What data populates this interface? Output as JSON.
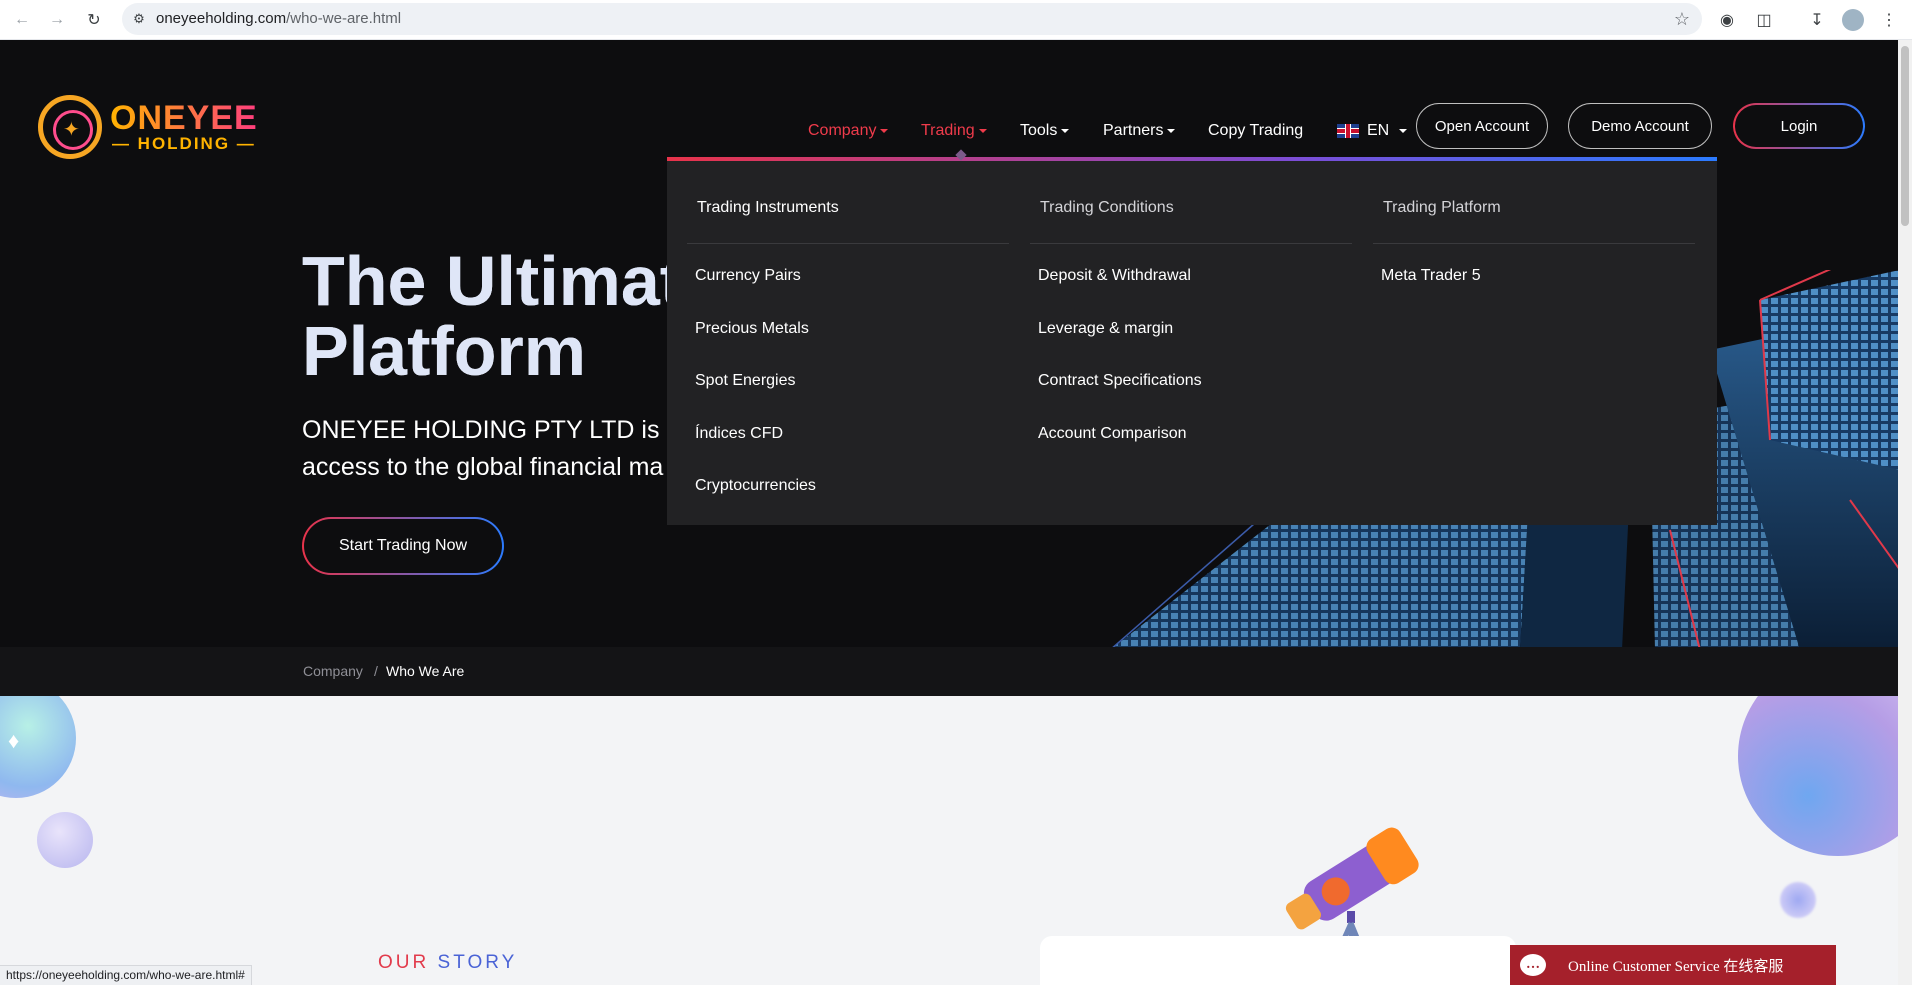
{
  "browser": {
    "url_host": "oneyeeholding.com",
    "url_path": "/who-we-are.html",
    "status_url": "https://oneyeeholding.com/who-we-are.html#"
  },
  "logo": {
    "line1": "ONEYEE",
    "line2": "— HOLDING —"
  },
  "nav": {
    "company": "Company",
    "trading": "Trading",
    "tools": "Tools",
    "partners": "Partners",
    "copy_trading": "Copy Trading",
    "language": "EN",
    "open_account": "Open Account",
    "demo_account": "Demo Account",
    "login": "Login"
  },
  "hero": {
    "headline_line1": "The Ultimat",
    "headline_line2": "Platform",
    "sub_line1": "ONEYEE HOLDING PTY LTD is",
    "sub_line2": "access to the global financial ma",
    "cta": "Start Trading Now"
  },
  "breadcrumb": {
    "parent": "Company",
    "separator": "/",
    "current": "Who We Are"
  },
  "dropdown": {
    "columns": [
      {
        "heading": "Trading Instruments",
        "items": [
          "Currency Pairs",
          "Precious Metals",
          "Spot Energies",
          "Índices CFD",
          "Cryptocurrencies"
        ]
      },
      {
        "heading": "Trading Conditions",
        "items": [
          "Deposit & Withdrawal",
          "Leverage & margin",
          "Contract Specifications",
          "Account Comparison"
        ]
      },
      {
        "heading": "Trading Platform",
        "items": [
          "Meta Trader 5"
        ]
      }
    ]
  },
  "story": {
    "word1": "OUR",
    "word2": "STORY"
  },
  "support": {
    "label": "Online Customer Service 在线客服"
  },
  "colors": {
    "accent_red": "#ef3b4b",
    "accent_blue": "#2b7bff",
    "hero_bg": "#0d0d0f",
    "dropdown_bg": "#222224",
    "support_bg": "#a5202b"
  }
}
